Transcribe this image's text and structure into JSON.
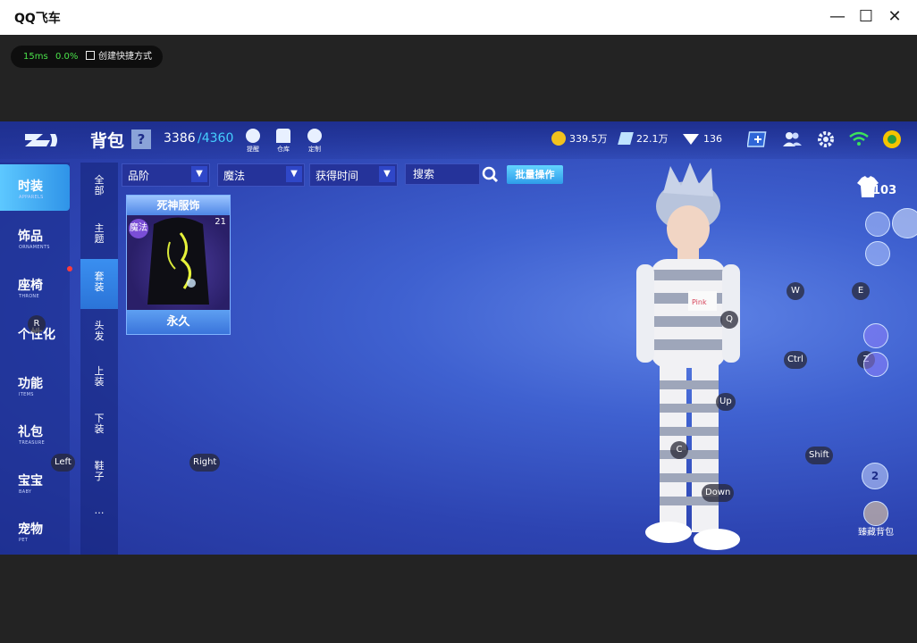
{
  "window": {
    "title": "QQ飞车",
    "minimize": "—",
    "maximize": "☐",
    "close": "✕"
  },
  "perf": {
    "latency": "15ms",
    "packet_loss": "0.0%",
    "shortcut_label": "创建快捷方式"
  },
  "header": {
    "title": "背包",
    "help": "?",
    "capacity_used": "3386",
    "capacity_total": "/4360",
    "icons": [
      {
        "label": "提醒",
        "icon": "bulb-icon"
      },
      {
        "label": "仓库",
        "icon": "warehouse-icon"
      },
      {
        "label": "定制",
        "icon": "customize-icon"
      }
    ],
    "currency": {
      "coins": "339.5万",
      "coupons": "22.1万",
      "diamonds": "136"
    }
  },
  "left_nav": [
    {
      "zh": "时装",
      "en": "APPARELS",
      "active": true
    },
    {
      "zh": "饰品",
      "en": "ORNAMENTS",
      "active": false
    },
    {
      "zh": "座椅",
      "en": "THRONE",
      "active": false
    },
    {
      "zh": "个性化",
      "en": "",
      "active": false
    },
    {
      "zh": "功能",
      "en": "ITEMS",
      "active": false
    },
    {
      "zh": "礼包",
      "en": "TREASURE",
      "active": false
    },
    {
      "zh": "宝宝",
      "en": "BABY",
      "active": false
    },
    {
      "zh": "宠物",
      "en": "PET",
      "active": false
    }
  ],
  "sub_nav": [
    {
      "label": "全部"
    },
    {
      "label": "主题"
    },
    {
      "label": "套装",
      "active": true
    },
    {
      "label": "头发"
    },
    {
      "label": "上装"
    },
    {
      "label": "下装"
    },
    {
      "label": "鞋子"
    },
    {
      "label": "…"
    }
  ],
  "filters": {
    "quality": "品阶",
    "type": "魔法",
    "sort": "获得时间",
    "search_placeholder": "搜索",
    "batch": "批量操作"
  },
  "items": [
    {
      "name": "死神服饰",
      "tag": "魔法",
      "level": "21",
      "duration": "永久"
    }
  ],
  "key_hints": {
    "R": "R",
    "Left": "Left",
    "Right": "Right",
    "Q": "Q",
    "Up": "Up",
    "C": "C",
    "Down": "Down",
    "W": "W",
    "E": "E",
    "Ctrl": "Ctrl",
    "Z": "Z",
    "Shift": "Shift"
  },
  "right_panel": {
    "outfit_level": "103",
    "wardrobe_badge": "2",
    "treasure_label": "臻藏背包"
  },
  "colors": {
    "accent": "#45cfff",
    "coin": "#f2c21d",
    "active_tab": "#3a8ff0"
  }
}
